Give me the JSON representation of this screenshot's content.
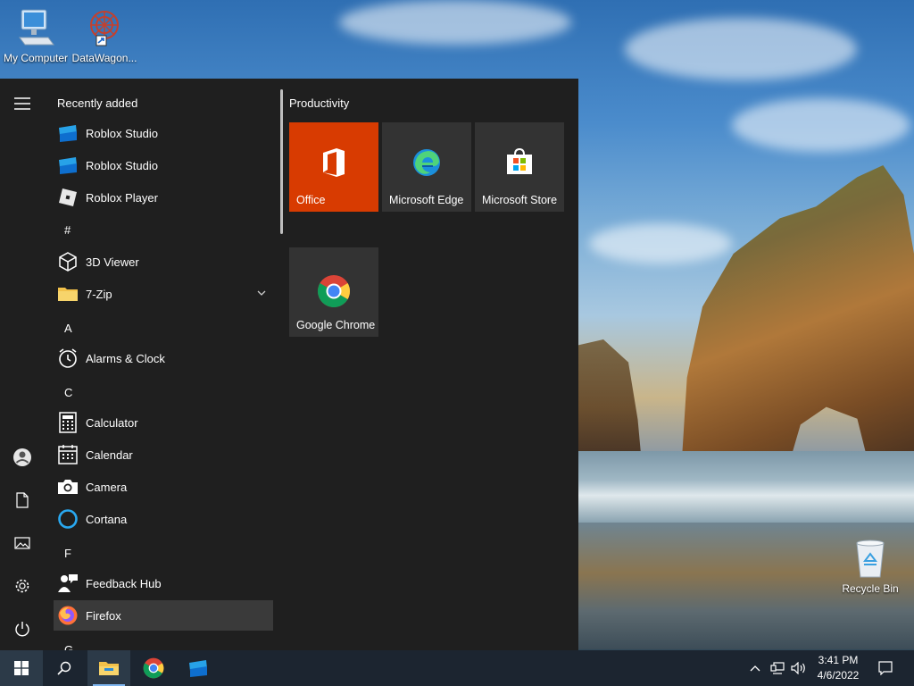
{
  "desktop": {
    "icons": [
      {
        "label": "My Computer"
      },
      {
        "label": "DataWagon..."
      },
      {
        "label": "Recycle Bin"
      }
    ]
  },
  "start_menu": {
    "rail": [
      {
        "icon": "hamburger-icon"
      },
      {
        "icon": "user-icon"
      },
      {
        "icon": "documents-icon"
      },
      {
        "icon": "pictures-icon"
      },
      {
        "icon": "settings-icon"
      },
      {
        "icon": "power-icon"
      }
    ],
    "app_list": {
      "recently_added_header": "Recently added",
      "recent": [
        {
          "label": "Roblox Studio"
        },
        {
          "label": "Roblox Studio"
        },
        {
          "label": "Roblox Player"
        }
      ],
      "headers": {
        "hash": "#",
        "a": "A",
        "c": "C",
        "f": "F",
        "g": "G"
      },
      "apps": [
        {
          "label": "3D Viewer"
        },
        {
          "label": "7-Zip"
        },
        {
          "label": "Alarms & Clock"
        },
        {
          "label": "Calculator"
        },
        {
          "label": "Calendar"
        },
        {
          "label": "Camera"
        },
        {
          "label": "Cortana"
        },
        {
          "label": "Feedback Hub"
        },
        {
          "label": "Firefox"
        }
      ]
    },
    "tiles": {
      "group_title": "Productivity",
      "items": [
        {
          "label": "Office",
          "color": "#d83b01"
        },
        {
          "label": "Microsoft Edge",
          "color": "#333333"
        },
        {
          "label": "Microsoft Store",
          "color": "#333333"
        },
        {
          "label": "Google Chrome",
          "color": "#333333"
        }
      ]
    }
  },
  "taskbar": {
    "clock_time": "3:41 PM",
    "clock_date": "4/6/2022"
  }
}
